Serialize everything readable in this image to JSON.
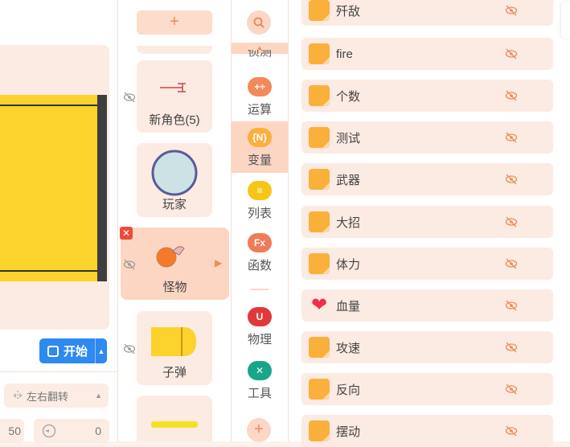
{
  "stage": {
    "start_label": "开始",
    "flip_label": "左右翻转",
    "x_value": "50",
    "rotation_value": "0"
  },
  "sprites": {
    "add_label": "+",
    "items": [
      {
        "name": "新角色(5)"
      },
      {
        "name": "玩家"
      },
      {
        "name": "怪物"
      },
      {
        "name": "子弹"
      }
    ]
  },
  "categories": {
    "search_icon": "search-icon",
    "partial_label": "侦测",
    "items": [
      {
        "label": "运算",
        "icon": "+÷",
        "color": "#f08a5a"
      },
      {
        "label": "变量",
        "icon": "{N}",
        "color": "#fbb03b"
      },
      {
        "label": "列表",
        "icon": "≡",
        "color": "#f5c518"
      },
      {
        "label": "函数",
        "icon": "Fx",
        "color": "#f07b5a"
      },
      {
        "label": "物理",
        "icon": "U",
        "color": "#e0393c"
      },
      {
        "label": "工具",
        "icon": "✕",
        "color": "#17a689"
      }
    ],
    "add_label": "+"
  },
  "variables": {
    "items": [
      {
        "name": "歼敌",
        "icon": "square"
      },
      {
        "name": "fire",
        "icon": "square"
      },
      {
        "name": "个数",
        "icon": "square"
      },
      {
        "name": "测试",
        "icon": "square"
      },
      {
        "name": "武器",
        "icon": "square"
      },
      {
        "name": "大招",
        "icon": "square"
      },
      {
        "name": "体力",
        "icon": "square"
      },
      {
        "name": "血量",
        "icon": "heart"
      },
      {
        "name": "攻速",
        "icon": "square"
      },
      {
        "name": "反向",
        "icon": "square"
      },
      {
        "name": "摆动",
        "icon": "square"
      }
    ]
  }
}
